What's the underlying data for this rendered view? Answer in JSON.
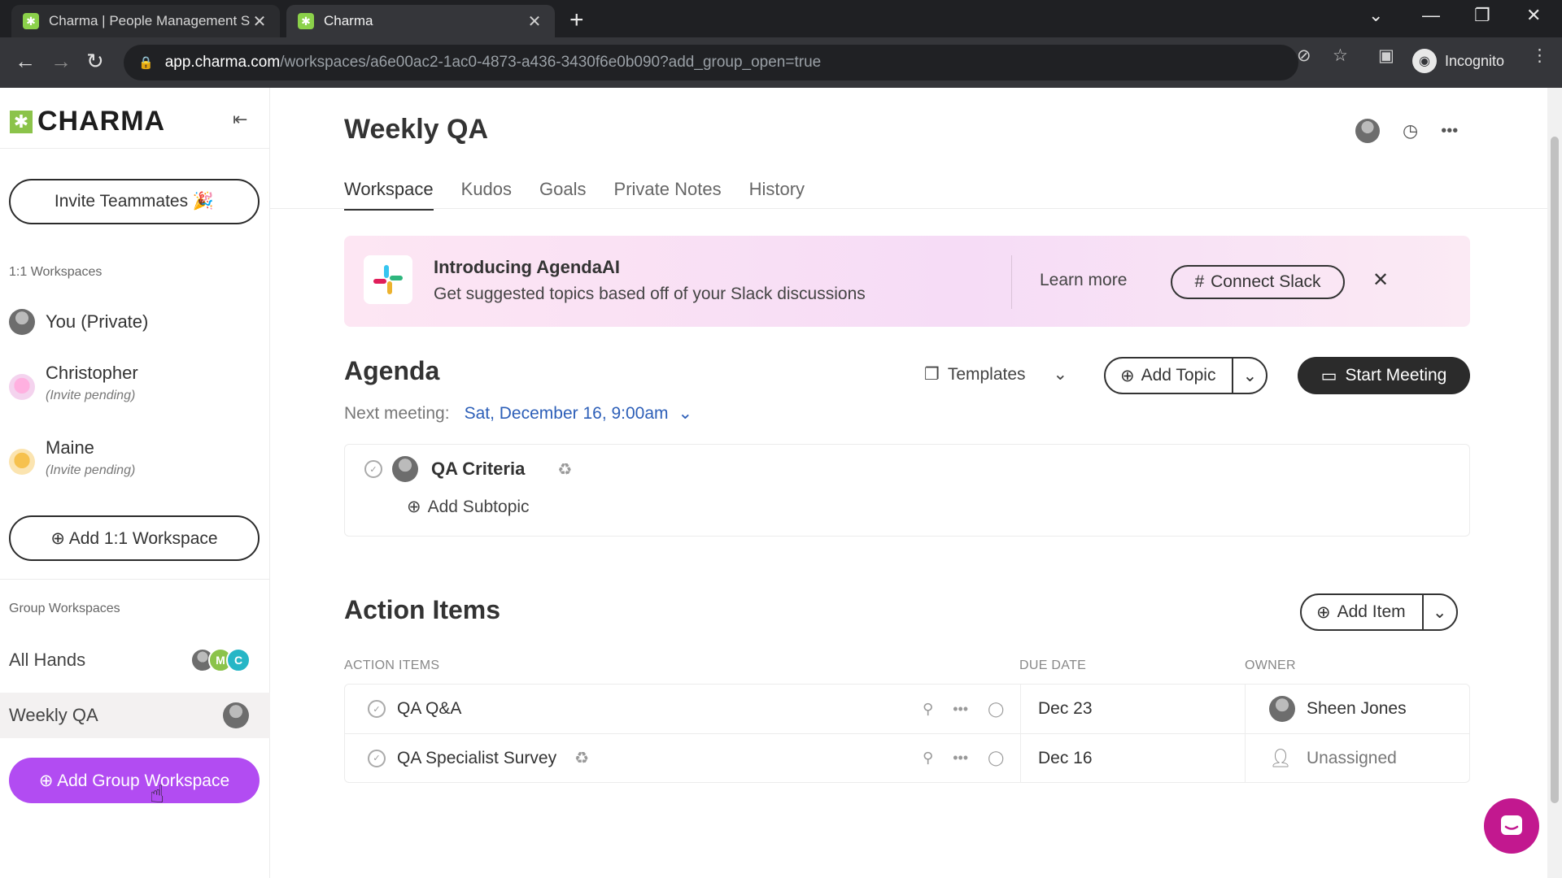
{
  "browser": {
    "tabs": [
      {
        "title": "Charma | People Management S",
        "close": "✕"
      },
      {
        "title": "Charma",
        "close": "✕"
      }
    ],
    "new_tab": "+",
    "url_host": "app.charma.com",
    "url_path": "/workspaces/a6e00ac2-1ac0-4873-a436-3430f6e0b090?add_group_open=true",
    "profile": "Incognito"
  },
  "sidebar": {
    "logo": "CHARMA",
    "invite_button": "Invite Teammates 🎉",
    "one_on_one_label": "1:1 Workspaces",
    "one_on_one": [
      {
        "name": "You (Private)",
        "sub": ""
      },
      {
        "name": "Christopher",
        "sub": "(Invite pending)"
      },
      {
        "name": "Maine",
        "sub": "(Invite pending)"
      }
    ],
    "add_one_on_one": "⊕ Add 1:1 Workspace",
    "group_label": "Group Workspaces",
    "groups": [
      {
        "name": "All Hands",
        "avatars": [
          "",
          "M",
          "C"
        ]
      },
      {
        "name": "Weekly QA"
      }
    ],
    "add_group": "⊕ Add Group Workspace"
  },
  "main": {
    "title": "Weekly QA",
    "tabs": [
      "Workspace",
      "Kudos",
      "Goals",
      "Private Notes",
      "History"
    ],
    "banner": {
      "title": "Introducing AgendaAI",
      "subtitle": "Get suggested topics based off of your Slack discussions",
      "learn_more": "Learn more",
      "connect": "Connect Slack"
    },
    "agenda": {
      "heading": "Agenda",
      "templates": "Templates",
      "add_topic": "Add Topic",
      "start_meeting": "Start Meeting",
      "next_meeting_label": "Next meeting:",
      "next_meeting_value": "Sat, December 16, 9:00am",
      "topics": [
        {
          "name": "QA Criteria"
        }
      ],
      "add_subtopic": "Add Subtopic"
    },
    "action_items": {
      "heading": "Action Items",
      "add_item": "Add Item",
      "columns": [
        "ACTION ITEMS",
        "DUE DATE",
        "OWNER"
      ],
      "rows": [
        {
          "title": "QA Q&A",
          "due": "Dec 23",
          "owner": "Sheen Jones"
        },
        {
          "title": "QA Specialist Survey",
          "due": "Dec 16",
          "owner": "Unassigned"
        }
      ]
    }
  },
  "colors": {
    "accent_purple": "#b24cf2",
    "link_blue": "#2d5fb8",
    "logo_green": "#8bc34a",
    "chat_magenta": "#c2188f"
  }
}
